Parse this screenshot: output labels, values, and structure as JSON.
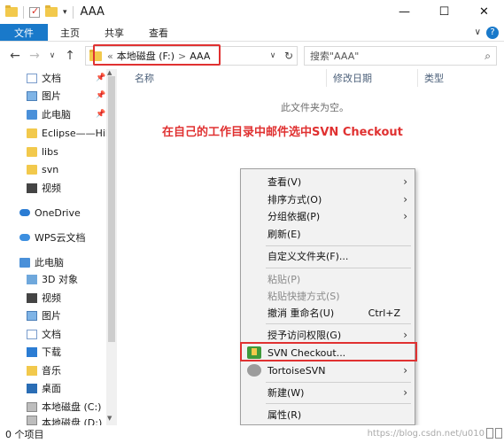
{
  "window": {
    "title": "AAA",
    "minimize": "—",
    "maximize": "☐",
    "close": "✕"
  },
  "ribbon": {
    "tabs": [
      "文件",
      "主页",
      "共享",
      "查看"
    ],
    "expand": "∨",
    "help": "?"
  },
  "address": {
    "back": "←",
    "forward": "→",
    "recent": "∨",
    "up": "↑",
    "breadcrumb_prefix": "«",
    "crumbs": [
      "本地磁盘 (F:)",
      "AAA"
    ],
    "crumb_sep": ">",
    "dropdown": "∨",
    "refresh": "↻",
    "search_placeholder": "搜索\"AAA\""
  },
  "sidebar": {
    "items": [
      {
        "label": "文档",
        "icon": "documents-icon",
        "pinned": true
      },
      {
        "label": "图片",
        "icon": "pictures-icon",
        "pinned": true
      },
      {
        "label": "此电脑",
        "icon": "this-pc-icon",
        "pinned": true
      },
      {
        "label": "Eclipse——Hib",
        "icon": "folder-icon",
        "pinned": false
      },
      {
        "label": "libs",
        "icon": "folder-icon",
        "pinned": false
      },
      {
        "label": "svn",
        "icon": "folder-icon",
        "pinned": false
      },
      {
        "label": "视频",
        "icon": "videos-icon",
        "pinned": false
      },
      {
        "label": "OneDrive",
        "icon": "onedrive-icon",
        "pinned": false
      },
      {
        "label": "WPS云文档",
        "icon": "wps-cloud-icon",
        "pinned": false
      },
      {
        "label": "此电脑",
        "icon": "this-pc-icon",
        "pinned": false
      },
      {
        "label": "3D 对象",
        "icon": "3d-objects-icon",
        "pinned": false
      },
      {
        "label": "视频",
        "icon": "videos-icon",
        "pinned": false
      },
      {
        "label": "图片",
        "icon": "pictures-icon",
        "pinned": false
      },
      {
        "label": "文档",
        "icon": "documents-icon",
        "pinned": false
      },
      {
        "label": "下载",
        "icon": "downloads-icon",
        "pinned": false
      },
      {
        "label": "音乐",
        "icon": "music-icon",
        "pinned": false
      },
      {
        "label": "桌面",
        "icon": "desktop-icon",
        "pinned": false
      },
      {
        "label": "本地磁盘 (C:)",
        "icon": "drive-icon",
        "pinned": false
      },
      {
        "label": "本地磁盘 (D:)",
        "icon": "drive-icon",
        "pinned": false
      }
    ]
  },
  "columns": {
    "name": "名称",
    "modified": "修改日期",
    "type": "类型"
  },
  "main": {
    "empty_text": "此文件夹为空。",
    "annotation": "在自己的工作目录中邮件选中SVN Checkout"
  },
  "context_menu": {
    "items": [
      {
        "label": "查看(V)",
        "submenu": true,
        "enabled": true
      },
      {
        "label": "排序方式(O)",
        "submenu": true,
        "enabled": true
      },
      {
        "label": "分组依据(P)",
        "submenu": true,
        "enabled": true
      },
      {
        "label": "刷新(E)",
        "submenu": false,
        "enabled": true
      },
      {
        "label": "自定义文件夹(F)...",
        "submenu": false,
        "enabled": true
      },
      {
        "label": "粘贴(P)",
        "submenu": false,
        "enabled": false
      },
      {
        "label": "粘贴快捷方式(S)",
        "submenu": false,
        "enabled": false
      },
      {
        "label": "撤消 重命名(U)",
        "submenu": false,
        "enabled": true,
        "shortcut": "Ctrl+Z"
      },
      {
        "label": "授予访问权限(G)",
        "submenu": true,
        "enabled": true
      },
      {
        "label": "SVN Checkout...",
        "submenu": false,
        "enabled": true,
        "highlighted": true
      },
      {
        "label": "TortoiseSVN",
        "submenu": true,
        "enabled": true
      },
      {
        "label": "新建(W)",
        "submenu": true,
        "enabled": true
      },
      {
        "label": "属性(R)",
        "submenu": false,
        "enabled": true
      }
    ],
    "arrow": "›"
  },
  "status": {
    "count": "0 个项目",
    "watermark": "https://blog.csdn.net/u010"
  },
  "colors": {
    "accent": "#1979ca",
    "highlight_border": "#e03131",
    "annotation_text": "#e03131"
  }
}
